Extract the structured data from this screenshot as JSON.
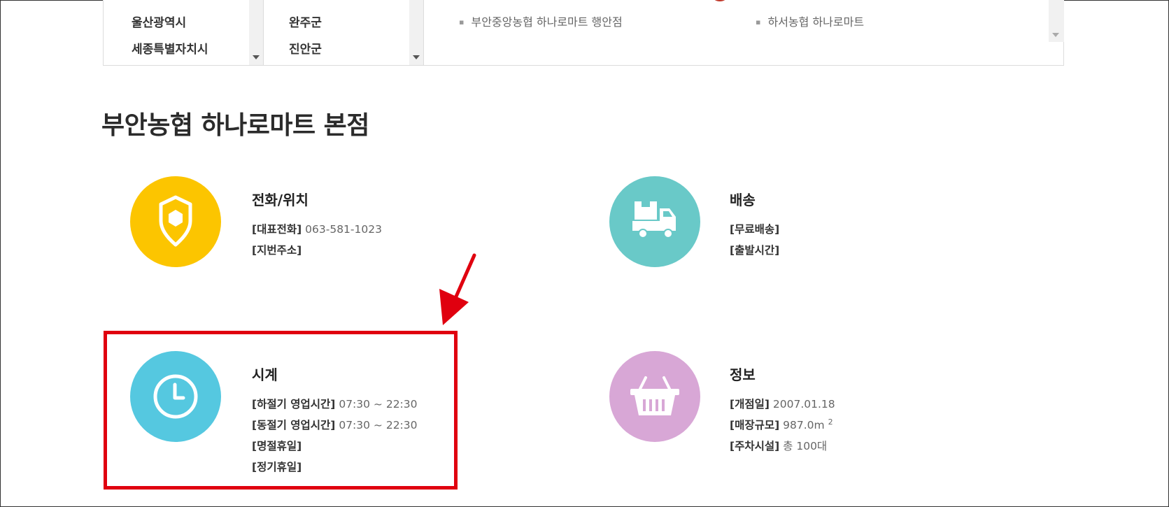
{
  "regions": [
    "울산광역시",
    "세종특별자치시"
  ],
  "counties": [
    "완주군",
    "진안군"
  ],
  "stores": [
    "부안중앙농협 하나로마트 행안점",
    "하서농협 하나로마트"
  ],
  "store_name": "부안농협 하나로마트 본점",
  "sections": {
    "contact": {
      "icon": "location-pin-icon",
      "title": "전화/위치",
      "rows": [
        {
          "label": "[대표전화]",
          "value": "063-581-1023"
        },
        {
          "label": "[지번주소]",
          "value": ""
        }
      ]
    },
    "delivery": {
      "icon": "delivery-truck-icon",
      "title": "배송",
      "rows": [
        {
          "label": "[무료배송]",
          "value": ""
        },
        {
          "label": "[출발시간]",
          "value": ""
        }
      ]
    },
    "hours": {
      "icon": "clock-icon",
      "title": "시계",
      "rows": [
        {
          "label": "[하절기 영업시간]",
          "value": "07:30 ~ 22:30"
        },
        {
          "label": "[동절기 영업시간]",
          "value": "07:30 ~ 22:30"
        },
        {
          "label": "[명절휴일]",
          "value": ""
        },
        {
          "label": "[정기휴일]",
          "value": ""
        }
      ]
    },
    "info": {
      "icon": "shopping-basket-icon",
      "title": "정보",
      "rows": [
        {
          "label": "[개점일]",
          "value": "2007.01.18"
        },
        {
          "label": "[매장규모]",
          "value": "987.0m",
          "sup": "2"
        },
        {
          "label": "[주차시설]",
          "value": "총 100대"
        }
      ]
    }
  },
  "colors": {
    "contact": "#fcc500",
    "delivery": "#69c9c8",
    "hours": "#55c8e0",
    "info": "#d8a7d6",
    "annotation": "#e0000f"
  }
}
